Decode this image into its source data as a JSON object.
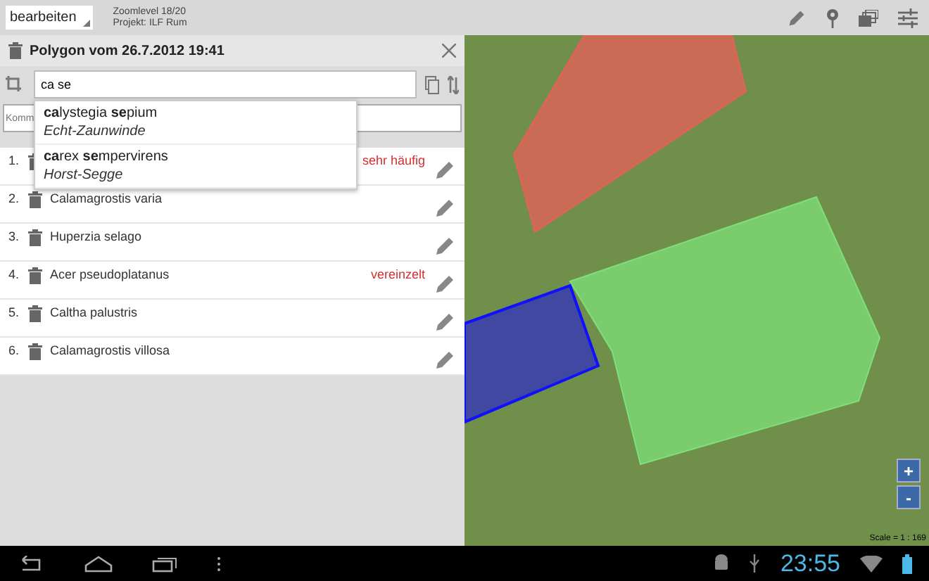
{
  "top_bar": {
    "mode_spinner": "bearbeiten",
    "zoom_level": "Zoomlevel 18/20",
    "project": "Projekt: ILF Rum"
  },
  "panel": {
    "title": "Polygon vom 26.7.2012 19:41",
    "search": {
      "value": "ca se"
    },
    "comment": {
      "placeholder": "Komm"
    },
    "suggestions": [
      {
        "name": "**ca**lystegia **se**pium",
        "common_name": "Echt-Zaunwinde"
      },
      {
        "name": "**ca**rex **se**mpervirens",
        "common_name": "Horst-Segge"
      }
    ],
    "species": [
      {
        "number": "1.",
        "frequency": "sehr häufig"
      },
      {
        "number": "2.",
        "name": "Calamagrostis varia"
      },
      {
        "number": "3.",
        "name": "Huperzia selago"
      },
      {
        "number": "4.",
        "name": "Acer pseudoplatanus",
        "frequency": "vereinzelt"
      },
      {
        "number": "5.",
        "name": "Caltha palustris"
      },
      {
        "number": "6.",
        "name": "Calamagrostis villosa"
      }
    ]
  },
  "map": {
    "zoom_in": "+",
    "zoom_out": "-",
    "scale": "Scale = 1 : 169",
    "polygons": [
      {
        "color": "#e8605a",
        "selected": false
      },
      {
        "color": "#7de07a",
        "selected": false
      },
      {
        "color": "#3030c0",
        "selected": true
      }
    ]
  },
  "system_bar": {
    "clock": "23:55"
  }
}
